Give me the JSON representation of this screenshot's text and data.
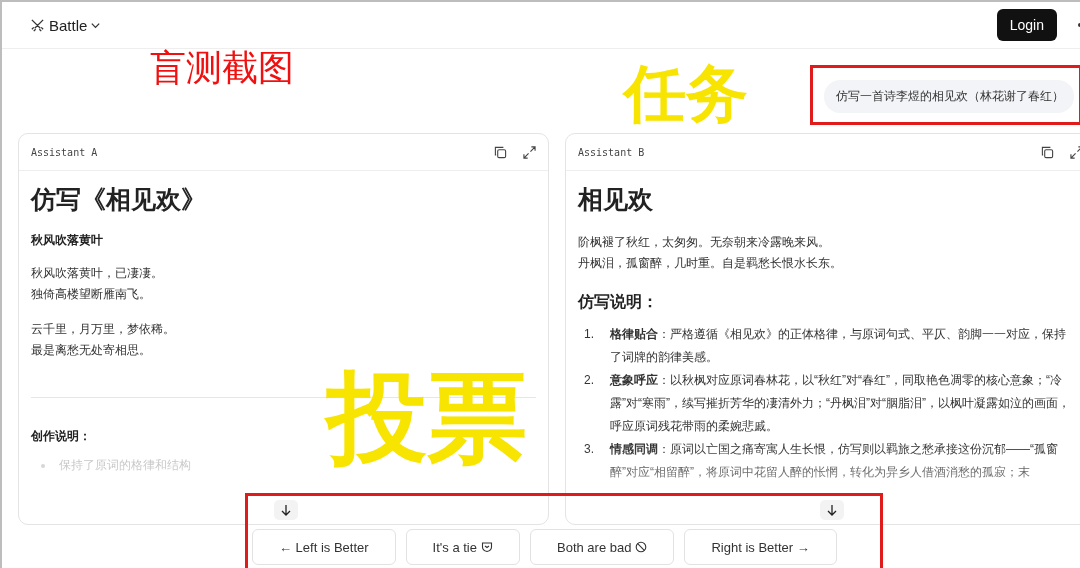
{
  "header": {
    "app": "Battle",
    "login": "Login"
  },
  "annotations": {
    "caption": "盲测截图",
    "task": "任务",
    "vote": "投票"
  },
  "prompt": "仿写一首诗李煜的相见欢（林花谢了春红）",
  "panels": [
    {
      "label": "Assistant A",
      "blocks": [
        {
          "kind": "title",
          "text": "仿写《相见欢》"
        },
        {
          "kind": "subheading",
          "text": "秋风吹落黄叶"
        },
        {
          "kind": "paragraph",
          "lines": [
            "秋风吹落黄叶，已凄凄。",
            "独倚高楼望断雁南飞。"
          ]
        },
        {
          "kind": "paragraph",
          "lines": [
            "云千里，月万里，梦依稀。",
            "最是离愁无处寄相思。"
          ]
        },
        {
          "kind": "divider"
        },
        {
          "kind": "heading",
          "text": "创作说明："
        },
        {
          "kind": "bullets",
          "items": [
            "保持了原词的格律和结构"
          ]
        }
      ]
    },
    {
      "label": "Assistant B",
      "blocks": [
        {
          "kind": "title",
          "text": "相见欢"
        },
        {
          "kind": "paragraph",
          "lines": [
            "阶枫褪了秋红，太匆匆。无奈朝来冷露晚来风。",
            "丹枫泪，孤窗醉，几时重。自是羁愁长恨水长东。"
          ]
        },
        {
          "kind": "heading",
          "text": "仿写说明："
        },
        {
          "kind": "numbered",
          "items": [
            {
              "number": "1.",
              "text": "**格律贴合**：严格遵循《相见欢》的正体格律，与原词句式、平仄、韵脚一一对应，保持了词牌的韵律美感。"
            },
            {
              "number": "2.",
              "text": "**意象呼应**：以秋枫对应原词春林花，以“秋红”对“春红”，同取艳色凋零的核心意象；“冷露”对“寒雨”，续写摧折芳华的凄清外力；“丹枫泪”对“胭脂泪”，以枫叶凝露如泣的画面，呼应原词残花带雨的柔婉悲戚。"
            },
            {
              "number": "3.",
              "text": "**情感同调**：原词以亡国之痛寄寓人生长恨，仿写则以羁旅之愁承接这份沉郁——“孤窗醉”对应“相留醉”，将原词中花留人醉的怅惘，转化为异乡人借酒消愁的孤寂；末"
            }
          ]
        }
      ]
    }
  ],
  "votes": [
    {
      "label": "← Left is Better",
      "kind": "plain"
    },
    {
      "label": "It's a tie",
      "kind": "tie"
    },
    {
      "label": "Both are bad",
      "kind": "bad"
    },
    {
      "label": "Right is Better →",
      "kind": "plain"
    }
  ]
}
